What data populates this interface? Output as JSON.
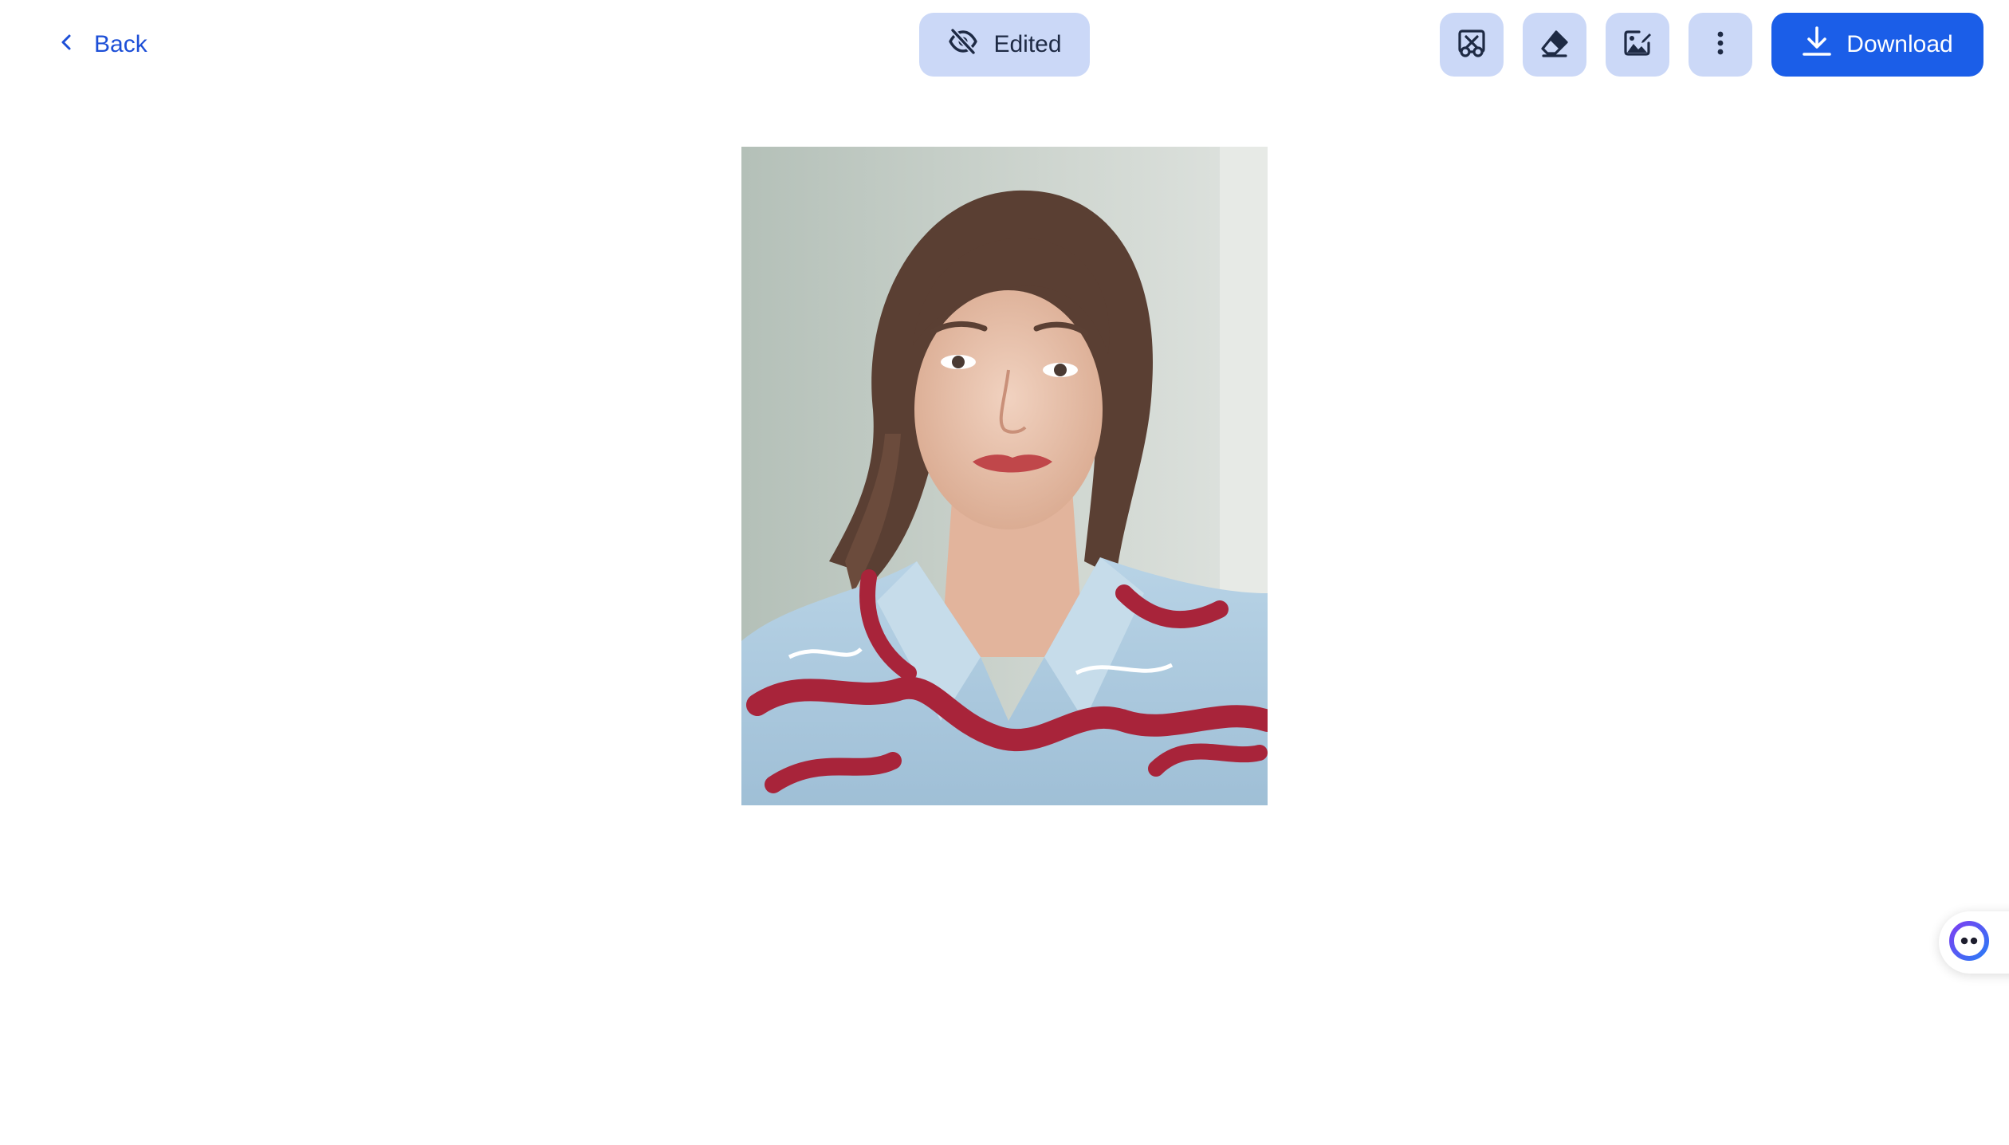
{
  "topbar": {
    "back_label": "Back",
    "edited_label": "Edited",
    "download_label": "Download",
    "tools": [
      {
        "icon": "remove-object-icon"
      },
      {
        "icon": "eraser-icon"
      },
      {
        "icon": "image-edit-icon"
      },
      {
        "icon": "more-vertical-icon"
      }
    ]
  },
  "preview": {
    "subject": "portrait photo of a woman with brown ponytail hair wearing a light blue shirt with red pattern"
  },
  "assistant": {
    "icon": "assistant-face-icon"
  },
  "colors": {
    "accent": "#1b5ee8",
    "accent_text": "#1d4fd7",
    "chip_bg": "#cbd8f7",
    "icon_dark": "#1e2a44"
  }
}
